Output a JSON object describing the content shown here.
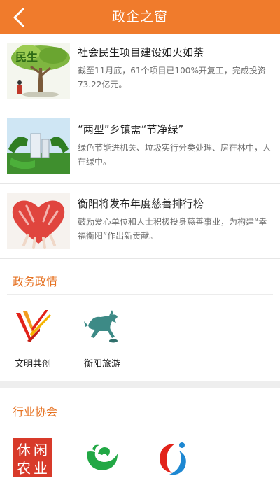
{
  "header": {
    "title": "政企之窗",
    "back_icon": "chevron-left-icon"
  },
  "news": [
    {
      "title": "社会民生项目建设如火如荼",
      "desc": "截至11月底，61个项目已100%开复工，完成投资73.22亿元。"
    },
    {
      "title": "“两型”乡镇需“节净绿”",
      "desc": "绿色节能进机关、垃圾实行分类处理、房在林中，人在绿中。"
    },
    {
      "title": "衡阳将发布年度慈善排行榜",
      "desc": "鼓励爱心单位和人士积极投身慈善事业，为构建“幸福衡阳”作出新贡献。"
    }
  ],
  "section_gov": {
    "title": "政务政情",
    "items": [
      {
        "label": "文明共创",
        "icon": "wenming-logo-icon"
      },
      {
        "label": "衡阳旅游",
        "icon": "bronze-horse-icon"
      }
    ]
  },
  "section_assoc": {
    "title": "行业协会",
    "items": [
      {
        "label": "",
        "icon": "leisure-agriculture-seal-icon",
        "text": "休闲农业"
      },
      {
        "label": "",
        "icon": "green-swirl-logo-icon"
      },
      {
        "label": "",
        "icon": "red-blue-logo-icon"
      }
    ]
  },
  "colors": {
    "accent": "#f07b2c",
    "section_title": "#e67222",
    "desc_text": "#6e6e6e"
  }
}
